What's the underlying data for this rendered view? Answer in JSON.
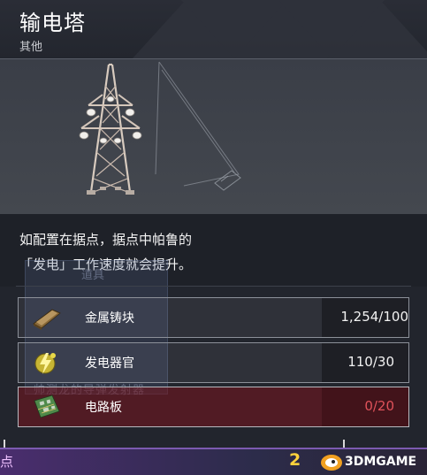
{
  "item": {
    "title": "输电塔",
    "category": "其他"
  },
  "description": {
    "line1": "如配置在据点，据点中帕鲁的",
    "line2": "「发电」工作速度就会提升。"
  },
  "background_ghost": {
    "label": "道具",
    "text": "帅测龙的导弹发射器"
  },
  "requirements": [
    {
      "name": "金属铸块",
      "count": "1,254/100",
      "icon": "metal-ingot-icon",
      "insufficient": false
    },
    {
      "name": "发电器官",
      "count": "110/30",
      "icon": "electric-organ-icon",
      "insufficient": false
    },
    {
      "name": "电路板",
      "count": "0/20",
      "icon": "circuit-board-icon",
      "insufficient": true
    }
  ],
  "bottom_bar": {
    "left_text": "点",
    "number": "2",
    "watermark": "3DMGAME"
  },
  "colors": {
    "panel_bg": "#22252d",
    "insufficient_row": "#78141e",
    "insufficient_text": "#e0525a",
    "accent_number": "#ffd23c",
    "bottom_bar": "#4a2d6e"
  }
}
